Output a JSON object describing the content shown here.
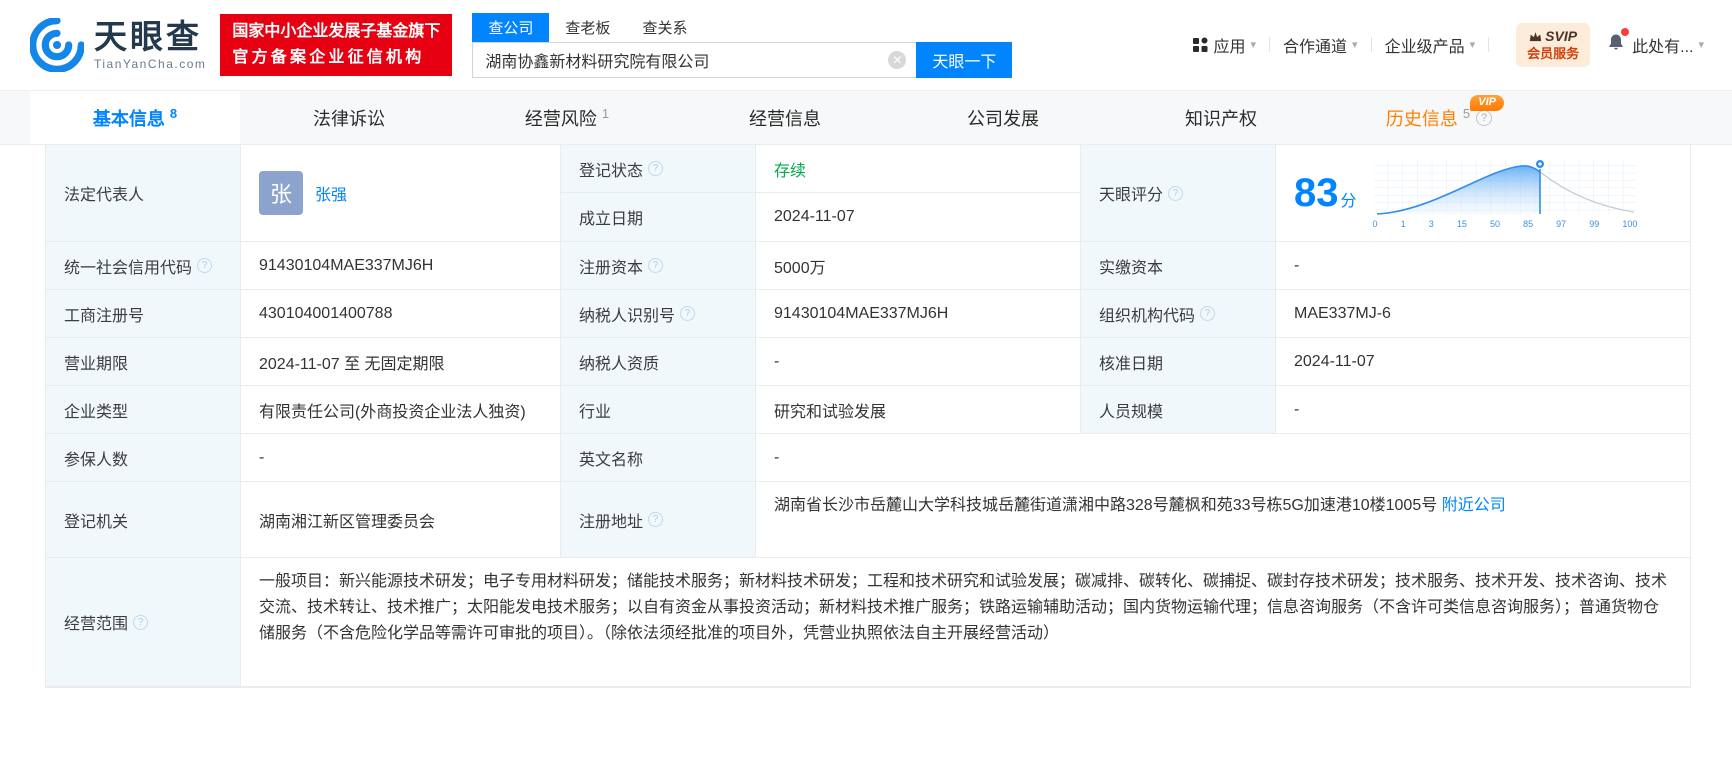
{
  "accent": "#0084ff",
  "header": {
    "brand": "天眼查",
    "brand_domain": "TianYanCha.com",
    "cert_badge_line1": "国家中小企业发展子基金旗下",
    "cert_badge_line2": "官方备案企业征信机构",
    "search_tabs": {
      "company": "查公司",
      "boss": "查老板",
      "relation": "查关系"
    },
    "search_value": "湖南协鑫新材料研究院有限公司",
    "search_button": "天眼一下",
    "nav_apps": "应用",
    "nav_partner": "合作通道",
    "nav_enterprise": "企业级产品",
    "svip_line1": "SVIP",
    "svip_line2": "会员服务",
    "nav_more": "此处有..."
  },
  "tabs": [
    {
      "label": "基本信息",
      "count": "8"
    },
    {
      "label": "法律诉讼",
      "count": ""
    },
    {
      "label": "经营风险",
      "count": "1"
    },
    {
      "label": "经营信息",
      "count": ""
    },
    {
      "label": "公司发展",
      "count": ""
    },
    {
      "label": "知识产权",
      "count": ""
    },
    {
      "label": "历史信息",
      "count": "5",
      "vip_label": "VIP"
    }
  ],
  "fields": {
    "legal_rep": {
      "label": "法定代表人",
      "avatar_char": "张",
      "name": "张强"
    },
    "reg_status": {
      "label": "登记状态",
      "value": "存续"
    },
    "establish_date": {
      "label": "成立日期",
      "value": "2024-11-07"
    },
    "score": {
      "label": "天眼评分",
      "score": "83",
      "unit": "分"
    },
    "credit_code": {
      "label": "统一社会信用代码",
      "value": "91430104MAE337MJ6H"
    },
    "reg_capital": {
      "label": "注册资本",
      "value": "5000万"
    },
    "paid_capital": {
      "label": "实缴资本",
      "value": "-"
    },
    "reg_number": {
      "label": "工商注册号",
      "value": "430104001400788"
    },
    "taxpayer_id": {
      "label": "纳税人识别号",
      "value": "91430104MAE337MJ6H"
    },
    "org_code": {
      "label": "组织机构代码",
      "value": "MAE337MJ-6"
    },
    "business_term": {
      "label": "营业期限",
      "value": "2024-11-07 至 无固定期限"
    },
    "taxpayer_quality": {
      "label": "纳税人资质",
      "value": "-"
    },
    "approval_date": {
      "label": "核准日期",
      "value": "2024-11-07"
    },
    "company_type": {
      "label": "企业类型",
      "value": "有限责任公司(外商投资企业法人独资)"
    },
    "industry": {
      "label": "行业",
      "value": "研究和试验发展"
    },
    "staff_size": {
      "label": "人员规模",
      "value": "-"
    },
    "insured_count": {
      "label": "参保人数",
      "value": "-"
    },
    "english_name": {
      "label": "英文名称",
      "value": "-"
    },
    "reg_authority": {
      "label": "登记机关",
      "value": "湖南湘江新区管理委员会"
    },
    "reg_address": {
      "label": "注册地址",
      "value": "湖南省长沙市岳麓山大学科技城岳麓街道潇湘中路328号麓枫和苑33号栋5G加速港10楼1005号",
      "link": "附近公司"
    },
    "business_scope": {
      "label": "经营范围",
      "value": "一般项目：新兴能源技术研发；电子专用材料研发；储能技术服务；新材料技术研发；工程和技术研究和试验发展；碳减排、碳转化、碳捕捉、碳封存技术研发；技术服务、技术开发、技术咨询、技术交流、技术转让、技术推广；太阳能发电技术服务；以自有资金从事投资活动；新材料技术推广服务；铁路运输辅助活动；国内货物运输代理；信息咨询服务（不含许可类信息咨询服务）；普通货物仓储服务（不含危险化学品等需许可审批的项目）。（除依法须经批准的项目外，凭营业执照依法自主开展经营活动）"
    }
  },
  "chart_data": {
    "type": "area",
    "title": "天眼评分分布曲线",
    "score": 83,
    "x_ticks": [
      "0",
      "1",
      "3",
      "15",
      "50",
      "85",
      "97",
      "99",
      "100"
    ],
    "marker_x": 83,
    "grid": true,
    "curve": "bell",
    "colors": {
      "fill": "#5aa7f2",
      "line": "#2f8df1",
      "rest": "#c3cbd4",
      "tick": "#3d8fe8"
    }
  }
}
